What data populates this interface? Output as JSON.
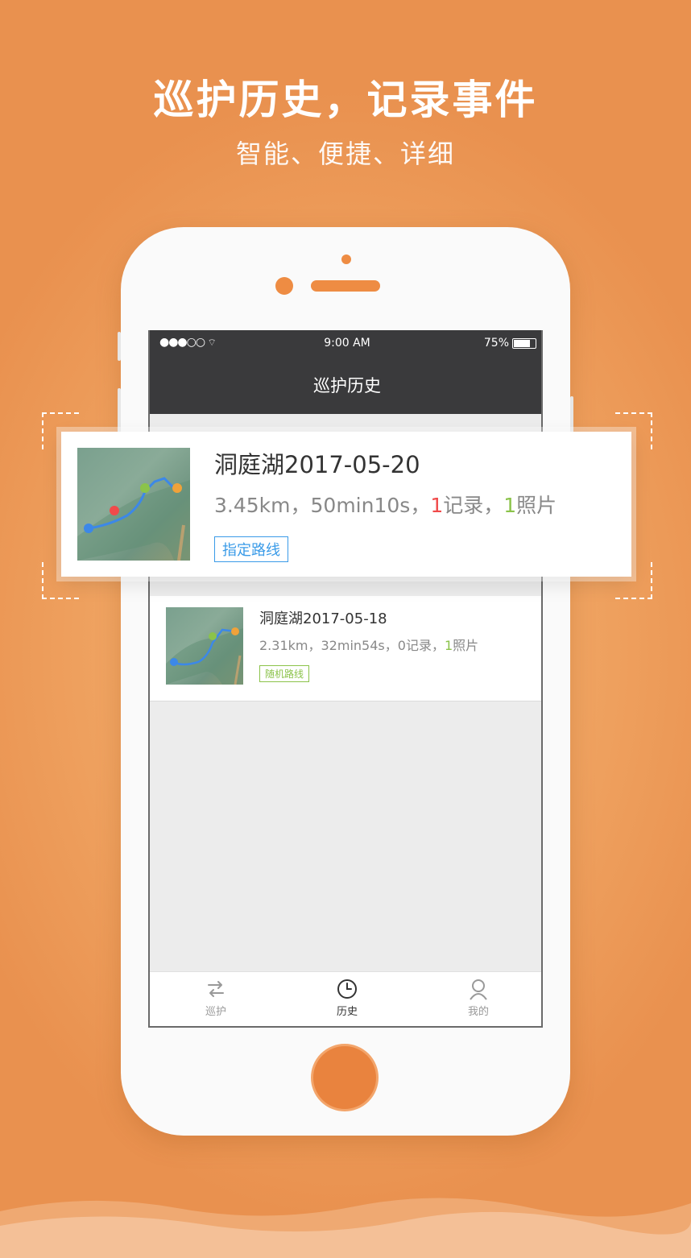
{
  "headline": "巡护历史，记录事件",
  "subhead": "智能、便捷、详细",
  "status_bar": {
    "signal": "●●●○○",
    "time": "9:00 AM",
    "battery": "75%"
  },
  "nav_title": "巡护历史",
  "featured_record": {
    "title": "洞庭湖2017-05-20",
    "distance": "3.45km",
    "duration": "50min10s",
    "records_count": "1",
    "records_label": "记录",
    "photos_count": "1",
    "photos_label": "照片",
    "separator": "，",
    "route_tag": "指定路线"
  },
  "second_record": {
    "title": "洞庭湖2017-05-18",
    "distance": "2.31km",
    "duration": "32min54s",
    "records_count": "0",
    "records_label": "记录",
    "photos_count": "1",
    "photos_label": "照片",
    "separator": "，",
    "route_tag": "随机路线"
  },
  "tabs": [
    {
      "label": "巡护",
      "icon": "patrol-route-icon"
    },
    {
      "label": "历史",
      "icon": "clock-icon"
    },
    {
      "label": "我的",
      "icon": "user-icon"
    }
  ],
  "colors": {
    "background": "#ee9a55",
    "accent_orange": "#e9833e",
    "nav_dark": "#3a3a3c",
    "tag_blue": "#3a9be8",
    "tag_green": "#8bc34a",
    "count_red": "#f04a4a"
  }
}
